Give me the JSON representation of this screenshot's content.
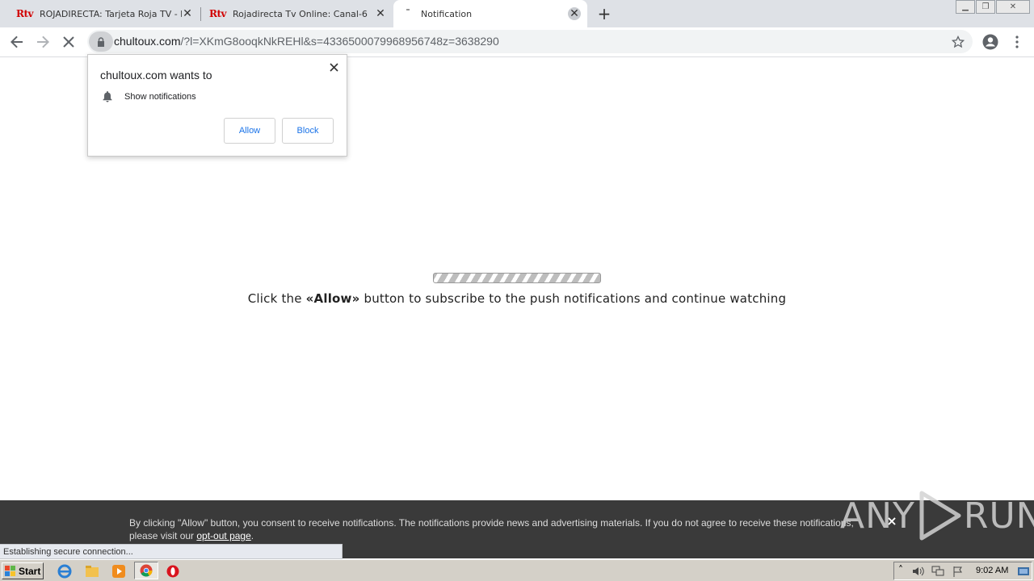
{
  "browser": {
    "tabs": [
      {
        "label": "ROJADIRECTA: Tarjeta Roja TV - Pir",
        "favicon": "Rtv"
      },
      {
        "label": "Rojadirecta Tv Online: Canal-6",
        "favicon": "Rtv"
      },
      {
        "label": "Notification",
        "favicon": ""
      }
    ],
    "url_domain": "chultoux.com",
    "url_rest": "/?l=XKmG8ooqkNkREHl&s=4336500079968956748z=3638290"
  },
  "permission": {
    "title": "chultoux.com wants to",
    "item": "Show notifications",
    "allow_label": "Allow",
    "block_label": "Block"
  },
  "page": {
    "progress": 1.0,
    "cta_prefix": "Click the ",
    "cta_bold": "«Allow»",
    "cta_suffix": " button to subscribe to the push notifications and continue watching"
  },
  "consent": {
    "text": "By clicking \"Allow\" button, you consent to receive notifications. The notifications provide news and advertising materials. If you do not agree to receive these notifications, please visit our ",
    "link": "opt-out page",
    "tail": ".",
    "close": "×"
  },
  "watermark": {
    "left": "ANY",
    "right": "RUN"
  },
  "status": "Establishing secure connection...",
  "taskbar": {
    "start": "Start",
    "clock": "9:02 AM"
  },
  "colors": {
    "accent": "#1a73e8",
    "rtv_red": "#d10000",
    "consent_bg": "#3a3a3a"
  }
}
